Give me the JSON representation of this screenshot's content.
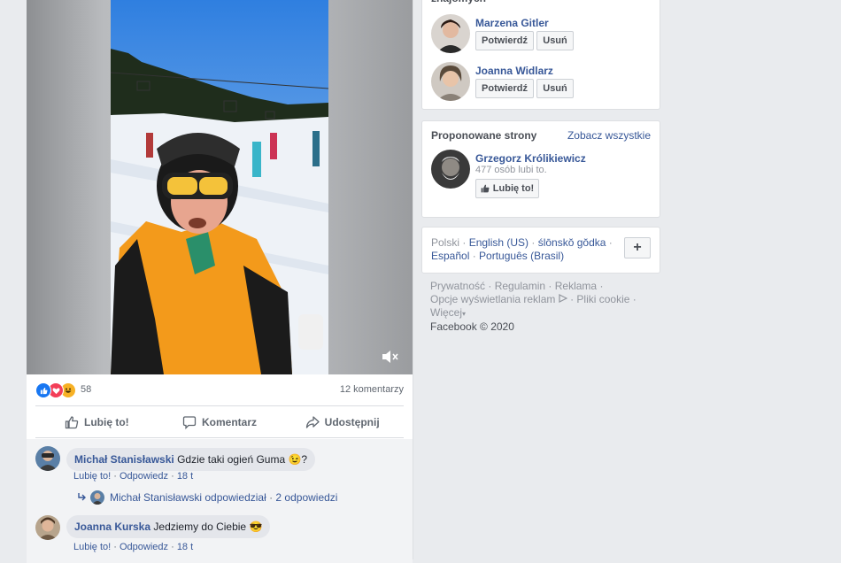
{
  "colors": {
    "link": "#385898",
    "muted": "#606770",
    "page_bg": "#e9ebee",
    "like_blue": "#1877f2"
  },
  "post": {
    "reactions": {
      "icons": [
        "like-icon",
        "love-icon",
        "haha-icon"
      ],
      "count": "58"
    },
    "comment_count": "12 komentarzy",
    "actions": {
      "like": "Lubię to!",
      "comment": "Komentarz",
      "share": "Udostępnij"
    },
    "comments": [
      {
        "author": "Michał Stanisławski",
        "text": "Gdzie taki ogień Guma 😉?",
        "like": "Lubię to!",
        "reply": "Odpowiedz",
        "time": "18 t",
        "replies_summary": {
          "who": "Michał Stanisławski odpowiedział",
          "sep": " · ",
          "count": "2 odpowiedzi"
        }
      },
      {
        "author": "Joanna Kurska",
        "text": "Jedziemy do Ciebie 😎",
        "like": "Lubię to!",
        "reply": "Odpowiedz",
        "time": "18 t"
      }
    ],
    "meta_sep": " · "
  },
  "sidebar": {
    "friend_requests": {
      "heading_cut": "znajomych",
      "people": [
        {
          "name": "Marzena Gitler",
          "confirm": "Potwierdź",
          "delete": "Usuń"
        },
        {
          "name": "Joanna Widlarz",
          "confirm": "Potwierdź",
          "delete": "Usuń"
        }
      ]
    },
    "suggested_pages": {
      "title": "Proponowane strony",
      "see_all": "Zobacz wszystkie",
      "page": {
        "name": "Grzegorz Królikiewicz",
        "likes": "477 osób lubi to.",
        "like_button": "Lubię to!"
      }
    },
    "languages": {
      "current": "Polski",
      "items": [
        "English (US)",
        "ślōnskŏ gŏdka",
        "Español",
        "Português (Brasil)"
      ],
      "sep": " · ",
      "plus": "+"
    },
    "footer": {
      "links": [
        "Prywatność",
        "Regulamin",
        "Reklama",
        "Opcje wyświetlania reklam",
        "Pliki cookie",
        "Więcej"
      ],
      "copyright": "Facebook © 2020"
    }
  }
}
